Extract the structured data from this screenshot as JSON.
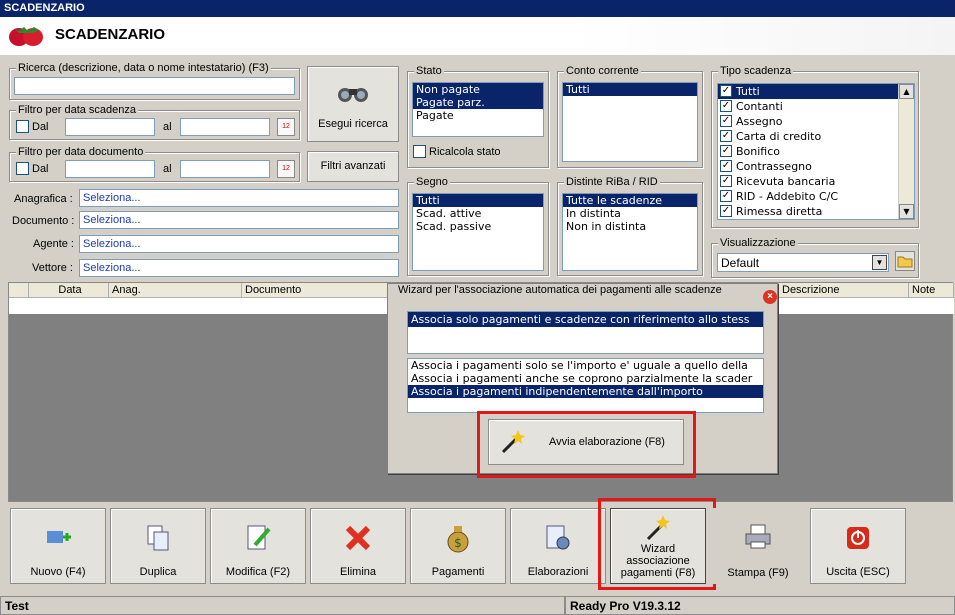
{
  "window": {
    "title": "SCADENZARIO"
  },
  "header": {
    "title": "SCADENZARIO"
  },
  "search": {
    "group_label": "Ricerca (descrizione, data o nome intestatario) (F3)",
    "value": "",
    "button_label": "Esegui ricerca"
  },
  "filter_scadenza": {
    "group_label": "Filtro per data scadenza",
    "dal_label": "Dal",
    "al_label": "al"
  },
  "filter_documento": {
    "group_label": "Filtro per data documento",
    "dal_label": "Dal",
    "al_label": "al"
  },
  "advanced_button": "Filtri avanzati",
  "anagrafica": {
    "label": "Anagrafica :",
    "value": "Seleziona..."
  },
  "documento": {
    "label": "Documento :",
    "value": "Seleziona..."
  },
  "agente": {
    "label": "Agente :",
    "value": "Seleziona..."
  },
  "vettore": {
    "label": "Vettore :",
    "value": "Seleziona..."
  },
  "stato": {
    "label": "Stato",
    "items": [
      "Non pagate",
      "Pagate parz.",
      "Pagate"
    ],
    "ricalcola_label": "Ricalcola stato"
  },
  "conto": {
    "label": "Conto corrente",
    "items": [
      "Tutti"
    ]
  },
  "segno": {
    "label": "Segno",
    "items": [
      "Tutti",
      "Scad. attive",
      "Scad. passive"
    ]
  },
  "distinte": {
    "label": "Distinte RiBa / RID",
    "items": [
      "Tutte le scadenze",
      "In distinta",
      "Non in distinta"
    ]
  },
  "tipo": {
    "label": "Tipo scadenza",
    "items": [
      "Tutti",
      "Contanti",
      "Assegno",
      "Carta di credito",
      "Bonifico",
      "Contrassegno",
      "Ricevuta bancaria",
      "RID - Addebito C/C",
      "Rimessa diretta"
    ]
  },
  "visualizzazione": {
    "label": "Visualizzazione",
    "value": "Default"
  },
  "grid": {
    "columns": [
      "Data",
      "Anag.",
      "Documento",
      "Descrizione",
      "Note"
    ]
  },
  "wizard": {
    "title": "Wizard per l'associazione automatica dei pagamenti alle scadenze",
    "list1": [
      "Associa solo pagamenti e scadenze con riferimento allo stess"
    ],
    "list2": [
      "Associa i pagamenti solo se l'importo e' uguale a quello della",
      "Associa i pagamenti anche se coprono parzialmente la scader",
      "Associa i pagamenti indipendentemente dall'importo"
    ],
    "button": "Avvia elaborazione (F8)"
  },
  "toolbar": {
    "nuovo": "Nuovo (F4)",
    "duplica": "Duplica",
    "modifica": "Modifica (F2)",
    "elimina": "Elimina",
    "pagamenti": "Pagamenti",
    "elaborazioni": "Elaborazioni",
    "wizard1": "Wizard",
    "wizard2": "associazione",
    "wizard3": "pagamenti (F8)",
    "stampa": "Stampa (F9)",
    "uscita": "Uscita (ESC)"
  },
  "status": {
    "left": "Test",
    "right": "Ready Pro V19.3.12"
  },
  "colors": {
    "selection": "#0a246a",
    "highlight": "#e01818"
  }
}
